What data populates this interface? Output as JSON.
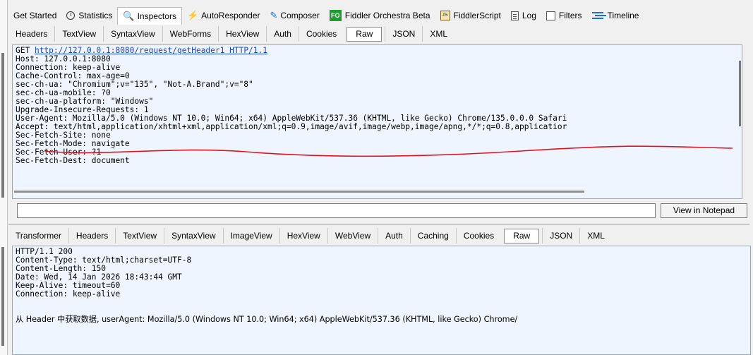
{
  "top_tabs": [
    {
      "label": "Get Started",
      "icon": "",
      "active": false
    },
    {
      "label": "Statistics",
      "icon": "clock-icon",
      "active": false
    },
    {
      "label": "Inspectors",
      "icon": "inspectors-icon",
      "active": true
    },
    {
      "label": "AutoResponder",
      "icon": "lightning-icon",
      "active": false
    },
    {
      "label": "Composer",
      "icon": "composer-icon",
      "active": false
    },
    {
      "label": "Fiddler Orchestra Beta",
      "icon": "fo-icon",
      "active": false
    },
    {
      "label": "FiddlerScript",
      "icon": "script-icon",
      "active": false
    },
    {
      "label": "Log",
      "icon": "log-icon",
      "active": false
    },
    {
      "label": "Filters",
      "icon": "checkbox-icon",
      "active": false
    },
    {
      "label": "Timeline",
      "icon": "timeline-icon",
      "active": false
    }
  ],
  "request": {
    "tabs": [
      "Headers",
      "TextView",
      "SyntaxView",
      "WebForms",
      "HexView",
      "Auth",
      "Cookies",
      "Raw",
      "JSON",
      "XML"
    ],
    "active_tab": "Raw",
    "method": "GET ",
    "url": "http://127.0.0.1:8080/request/getHeader1",
    "protocol": " HTTP/1.1",
    "lines": [
      "Host: 127.0.0.1:8080",
      "Connection: keep-alive",
      "Cache-Control: max-age=0",
      "sec-ch-ua: \"Chromium\";v=\"135\", \"Not-A.Brand\";v=\"8\"",
      "sec-ch-ua-mobile: ?0",
      "sec-ch-ua-platform: \"Windows\"",
      "Upgrade-Insecure-Requests: 1",
      "User-Agent: Mozilla/5.0 (Windows NT 10.0; Win64; x64) AppleWebKit/537.36 (KHTML, like Gecko) Chrome/135.0.0.0 Safari",
      "Accept: text/html,application/xhtml+xml,application/xml;q=0.9,image/avif,image/webp,image/apng,*/*;q=0.8,applicatior",
      "Sec-Fetch-Site: none",
      "Sec-Fetch-Mode: navigate",
      "Sec-Fetch-User: ?1",
      "Sec-Fetch-Dest: document"
    ],
    "annotation_color": "#e0141e"
  },
  "notes_input": {
    "value": ""
  },
  "view_in_notepad_label": "View in Notepad",
  "response": {
    "tabs": [
      "Transformer",
      "Headers",
      "TextView",
      "SyntaxView",
      "ImageView",
      "HexView",
      "WebView",
      "Auth",
      "Caching",
      "Cookies",
      "Raw",
      "JSON",
      "XML"
    ],
    "active_tab": "Raw",
    "lines": [
      "HTTP/1.1 200",
      "Content-Type: text/html;charset=UTF-8",
      "Content-Length: 150",
      "Date: Wed, 14 Jan 2026 18:43:44 GMT",
      "Keep-Alive: timeout=60",
      "Connection: keep-alive",
      "",
      ""
    ],
    "body": "从 Header 中获取数据, userAgent: Mozilla/5.0 (Windows NT 10.0; Win64; x64) AppleWebKit/537.36 (KHTML, like Gecko) Chrome/"
  },
  "colors": {
    "pane_bg": "#eef5ff",
    "link": "#1a47c9",
    "fo_green": "#1f9b2f",
    "timeline_blue": "#1f6fd1"
  }
}
